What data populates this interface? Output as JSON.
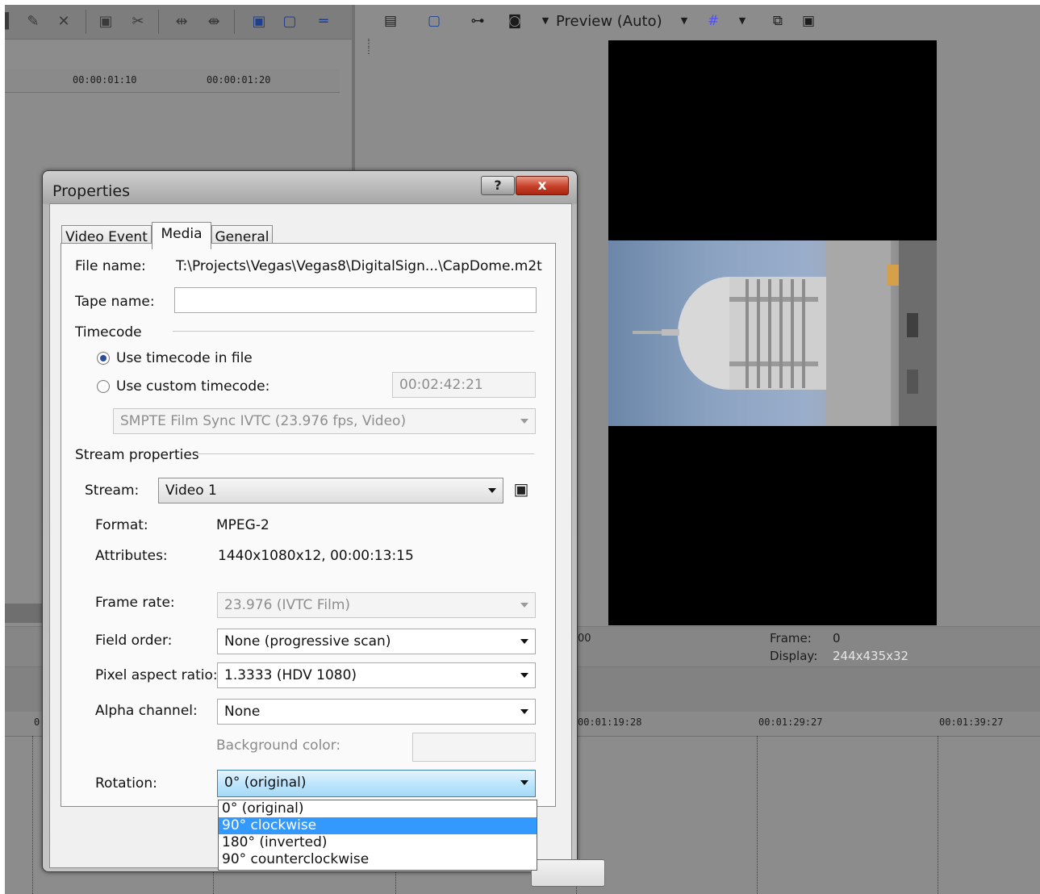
{
  "preview": {
    "mode_label": "Preview (Auto)",
    "frame_label": "Frame:",
    "frame_value": "0",
    "display_label": "Display:",
    "display_value": "244x435x32"
  },
  "timeline": {
    "top_ruler": [
      "00:00:01:10",
      "00:00:01:20"
    ],
    "bottom_ruler": [
      "00:01:19:28",
      "00:01:29:27",
      "00:01:39:27"
    ],
    "stray_left": "0",
    "stray_right": "00"
  },
  "icons": {
    "help_glyph": "?",
    "close_glyph": "x"
  },
  "dialog": {
    "title": "Properties",
    "tabs": [
      "Video Event",
      "Media",
      "General"
    ],
    "active_tab": "Media",
    "file_name_label": "File name:",
    "file_name_value": "T:\\Projects\\Vegas\\Vegas8\\DigitalSign...\\CapDome.m2t",
    "tape_name_label": "Tape name:",
    "tape_name_value": "",
    "timecode_group": "Timecode",
    "use_timecode_label": "Use timecode in file",
    "use_custom_label": "Use custom timecode:",
    "custom_timecode_value": "00:02:42:21",
    "timecode_format": "SMPTE Film Sync IVTC (23.976 fps, Video)",
    "stream_group": "Stream properties",
    "stream_label": "Stream:",
    "stream_value": "Video 1",
    "format_label": "Format:",
    "format_value": "MPEG-2",
    "attributes_label": "Attributes:",
    "attributes_value": "1440x1080x12, 00:00:13:15",
    "frame_rate_label": "Frame rate:",
    "frame_rate_value": "23.976 (IVTC Film)",
    "field_order_label": "Field order:",
    "field_order_value": "None (progressive scan)",
    "pixel_aspect_label": "Pixel aspect ratio:",
    "pixel_aspect_value": "1.3333 (HDV 1080)",
    "alpha_label": "Alpha channel:",
    "alpha_value": "None",
    "bg_color_label": "Background color:",
    "rotation_label": "Rotation:",
    "rotation_value": "0° (original)",
    "rotation_options": [
      "0° (original)",
      "90° clockwise",
      "180° (inverted)",
      "90° counterclockwise"
    ],
    "rotation_highlighted": "90° clockwise"
  }
}
